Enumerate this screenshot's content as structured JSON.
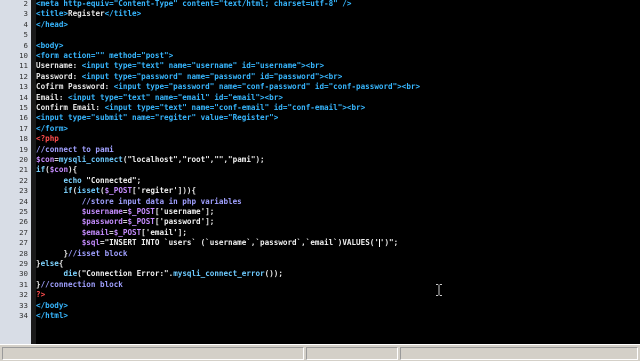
{
  "editor": {
    "lines": [
      {
        "n": "2",
        "parts": [
          [
            "tag",
            "<meta http-equiv=\"Content-Type\" content=\"text/html; charset=utf-8\" />"
          ]
        ]
      },
      {
        "n": "3",
        "parts": [
          [
            "tag",
            "<title>"
          ],
          [
            "txt",
            "Register"
          ],
          [
            "tag",
            "</title>"
          ]
        ]
      },
      {
        "n": "4",
        "parts": [
          [
            "tag",
            "</head>"
          ]
        ]
      },
      {
        "n": "5",
        "parts": []
      },
      {
        "n": "6",
        "parts": [
          [
            "tag",
            "<body>"
          ]
        ]
      },
      {
        "n": "10",
        "parts": [
          [
            "tag",
            "<form action=\"\" method=\"post\">"
          ]
        ]
      },
      {
        "n": "11",
        "parts": [
          [
            "txt",
            "Username: "
          ],
          [
            "tag",
            "<input type=\"text\" name=\"username\" id=\"username\">"
          ],
          [
            "tag",
            "<br>"
          ]
        ]
      },
      {
        "n": "12",
        "parts": [
          [
            "txt",
            "Password: "
          ],
          [
            "tag",
            "<input type=\"password\" name=\"password\" id=\"password\">"
          ],
          [
            "tag",
            "<br>"
          ]
        ]
      },
      {
        "n": "13",
        "parts": [
          [
            "txt",
            "Cofirm Password: "
          ],
          [
            "tag",
            "<input type=\"password\" name=\"conf-password\" id=\"conf-password\">"
          ],
          [
            "tag",
            "<br>"
          ]
        ]
      },
      {
        "n": "14",
        "parts": [
          [
            "txt",
            "Email: "
          ],
          [
            "tag",
            "<input type=\"text\" name=\"email\" id=\"email\">"
          ],
          [
            "tag",
            "<br>"
          ]
        ]
      },
      {
        "n": "15",
        "parts": [
          [
            "txt",
            "Confirm Email: "
          ],
          [
            "tag",
            "<input type=\"text\" name=\"conf-email\" id=\"conf-email\">"
          ],
          [
            "tag",
            "<br>"
          ]
        ]
      },
      {
        "n": "16",
        "parts": [
          [
            "tag",
            "<input type=\"submit\" name=\"regiter\" value=\"Register\">"
          ]
        ]
      },
      {
        "n": "17",
        "parts": [
          [
            "tag",
            "</form>"
          ]
        ]
      },
      {
        "n": "18",
        "parts": [
          [
            "php",
            "<?php"
          ]
        ]
      },
      {
        "n": "19",
        "parts": [
          [
            "cm",
            "//connect to pami"
          ]
        ]
      },
      {
        "n": "20",
        "parts": [
          [
            "var",
            "$con"
          ],
          [
            "txt",
            "="
          ],
          [
            "fn",
            "mysqli_connect"
          ],
          [
            "txt",
            "("
          ],
          [
            "str",
            "\"localhost\",\"root\",\"\",\"pami\""
          ],
          [
            "txt",
            ");"
          ]
        ]
      },
      {
        "n": "21",
        "parts": [
          [
            "kw",
            "if"
          ],
          [
            "txt",
            "("
          ],
          [
            "var",
            "$con"
          ],
          [
            "txt",
            "){"
          ]
        ]
      },
      {
        "n": "22",
        "parts": [
          [
            "txt",
            "      "
          ],
          [
            "kw",
            "echo"
          ],
          [
            "str",
            " \"Connected\""
          ],
          [
            "txt",
            ";"
          ]
        ]
      },
      {
        "n": "23",
        "parts": [
          [
            "txt",
            "      "
          ],
          [
            "kw",
            "if"
          ],
          [
            "txt",
            "("
          ],
          [
            "fn",
            "isset"
          ],
          [
            "txt",
            "("
          ],
          [
            "var",
            "$_POST"
          ],
          [
            "txt",
            "["
          ],
          [
            "str",
            "'regiter'"
          ],
          [
            "txt",
            "])){"
          ]
        ]
      },
      {
        "n": "24",
        "parts": [
          [
            "txt",
            "          "
          ],
          [
            "cm",
            "//store input data in php variables"
          ]
        ]
      },
      {
        "n": "25",
        "parts": [
          [
            "txt",
            "          "
          ],
          [
            "var",
            "$username"
          ],
          [
            "txt",
            "="
          ],
          [
            "var",
            "$_POST"
          ],
          [
            "txt",
            "["
          ],
          [
            "str",
            "'username'"
          ],
          [
            "txt",
            "];"
          ]
        ]
      },
      {
        "n": "26",
        "parts": [
          [
            "txt",
            "          "
          ],
          [
            "var",
            "$password"
          ],
          [
            "txt",
            "="
          ],
          [
            "var",
            "$_POST"
          ],
          [
            "txt",
            "["
          ],
          [
            "str",
            "'password'"
          ],
          [
            "txt",
            "];"
          ]
        ]
      },
      {
        "n": "27",
        "parts": [
          [
            "txt",
            "          "
          ],
          [
            "var",
            "$email"
          ],
          [
            "txt",
            "="
          ],
          [
            "var",
            "$_POST"
          ],
          [
            "txt",
            "["
          ],
          [
            "str",
            "'email'"
          ],
          [
            "txt",
            "];"
          ]
        ]
      },
      {
        "n": "27",
        "parts": [
          [
            "txt",
            "          "
          ],
          [
            "var",
            "$sql"
          ],
          [
            "txt",
            "="
          ],
          [
            "str",
            "\"INSERT INTO `users` (`username`,`password`,`email`)VALUES('"
          ],
          [
            "caret",
            ""
          ],
          [
            "str",
            "')\""
          ],
          [
            "txt",
            ";"
          ]
        ]
      },
      {
        "n": "28",
        "parts": [
          [
            "txt",
            "      "
          ],
          [
            "txt",
            "}"
          ],
          [
            "cm",
            "//isset block"
          ]
        ]
      },
      {
        "n": "29",
        "parts": [
          [
            "txt",
            "}"
          ],
          [
            "kw",
            "else"
          ],
          [
            "txt",
            "{"
          ]
        ]
      },
      {
        "n": "30",
        "parts": [
          [
            "txt",
            "      "
          ],
          [
            "kw",
            "die"
          ],
          [
            "txt",
            "("
          ],
          [
            "str",
            "\"Connection Error:\""
          ],
          [
            "txt",
            "."
          ],
          [
            "fn",
            "mysqli_connect_error"
          ],
          [
            "txt",
            "());"
          ]
        ]
      },
      {
        "n": "31",
        "parts": [
          [
            "txt",
            "}"
          ],
          [
            "cm",
            "//connection block"
          ]
        ]
      },
      {
        "n": "32",
        "parts": [
          [
            "php",
            "?>"
          ]
        ]
      },
      {
        "n": "33",
        "parts": [
          [
            "tag",
            "</body>"
          ]
        ]
      },
      {
        "n": "34",
        "parts": [
          [
            "tag",
            "</html>"
          ]
        ]
      }
    ]
  },
  "icons": {
    "mouse_cursor": "ibeam-cursor-icon"
  }
}
